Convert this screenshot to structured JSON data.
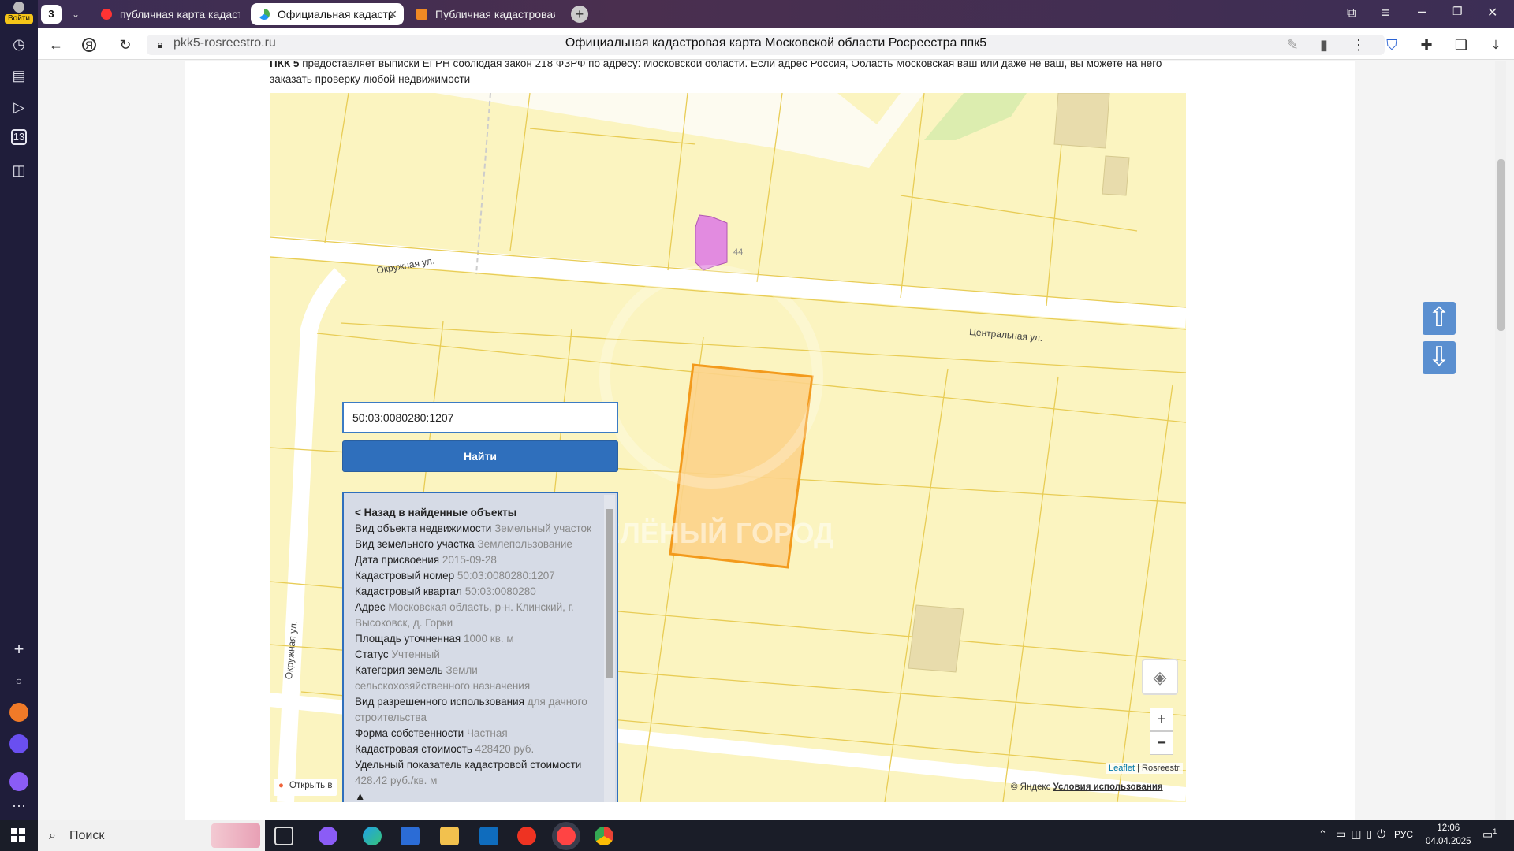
{
  "browser": {
    "login_label": "Войти",
    "tab_count": "3",
    "tabs": [
      {
        "label": "публичная карта кадастр",
        "active": false
      },
      {
        "label": "Официальная кадастр",
        "active": true
      },
      {
        "label": "Публичная кадастровая",
        "active": false
      }
    ],
    "url": "pkk5-rosreestro.ru",
    "page_title": "Официальная кадастровая карта Московской области Росреестра ппк5"
  },
  "sidebar": {
    "calendar_day": "13"
  },
  "page": {
    "intro_bold": "ПКК 5",
    "intro_text": " предоставляет выписки ЕГРН соблюдая закон 218 ФЗРФ по адресу: Московской области. Если адрес Россия, Область Московская ваш или даже не ваш, вы можете на него заказать проверку любой недвижимости"
  },
  "map": {
    "search_value": "50:03:0080280:1207",
    "find_label": "Найти",
    "street_labels": {
      "okruzhnaya_top": "Окружная ул.",
      "tsentralnaya": "Центральная ул.",
      "okruzhnaya_left": "Окружная ул."
    },
    "house_number": "44",
    "watermark": "ЗЕЛЁНЫЙ ГОРОД",
    "info": {
      "back_label": "< Назад в найденные объекты",
      "rows": [
        {
          "key": "Вид объекта недвижимости",
          "value": "Земельный участок"
        },
        {
          "key": "Вид земельного участка",
          "value": "Землепользование"
        },
        {
          "key": "Дата присвоения",
          "value": "2015-09-28"
        },
        {
          "key": "Кадастровый номер",
          "value": "50:03:0080280:1207"
        },
        {
          "key": "Кадастровый квартал",
          "value": "50:03:0080280"
        },
        {
          "key": "Адрес",
          "value": "Московская область, р-н. Клинский, г. Высоковск, д. Горки"
        },
        {
          "key": "Площадь уточненная",
          "value": "1000 кв. м"
        },
        {
          "key": "Статус",
          "value": "Учтенный"
        },
        {
          "key": "Категория земель",
          "value": "Земли сельскохозяйственного назначения"
        },
        {
          "key": "Вид разрешенного использования",
          "value": "для дачного строительства"
        },
        {
          "key": "Форма собственности",
          "value": "Частная"
        },
        {
          "key": "Кадастровая стоимость",
          "value": "428420 руб."
        },
        {
          "key": "Удельный показатель кадастровой стоимости",
          "value": "428.42 руб./кв. м"
        }
      ],
      "collapse_glyph": "▲"
    },
    "open_label": "Открыть в",
    "zoom_in": "+",
    "zoom_out": "−",
    "attribution_leaflet": "Leaflet",
    "attribution_sep": " | ",
    "attribution_rosreestr": "Rosreestr",
    "yandex_copy": "© Яндекс",
    "yandex_terms": "Условия использования"
  },
  "scroll_up": "⇧",
  "scroll_down": "⇩",
  "taskbar": {
    "search_label": "Поиск",
    "lang": "РУС",
    "time": "12:06",
    "date": "04.04.2025",
    "notif_count": "1"
  }
}
